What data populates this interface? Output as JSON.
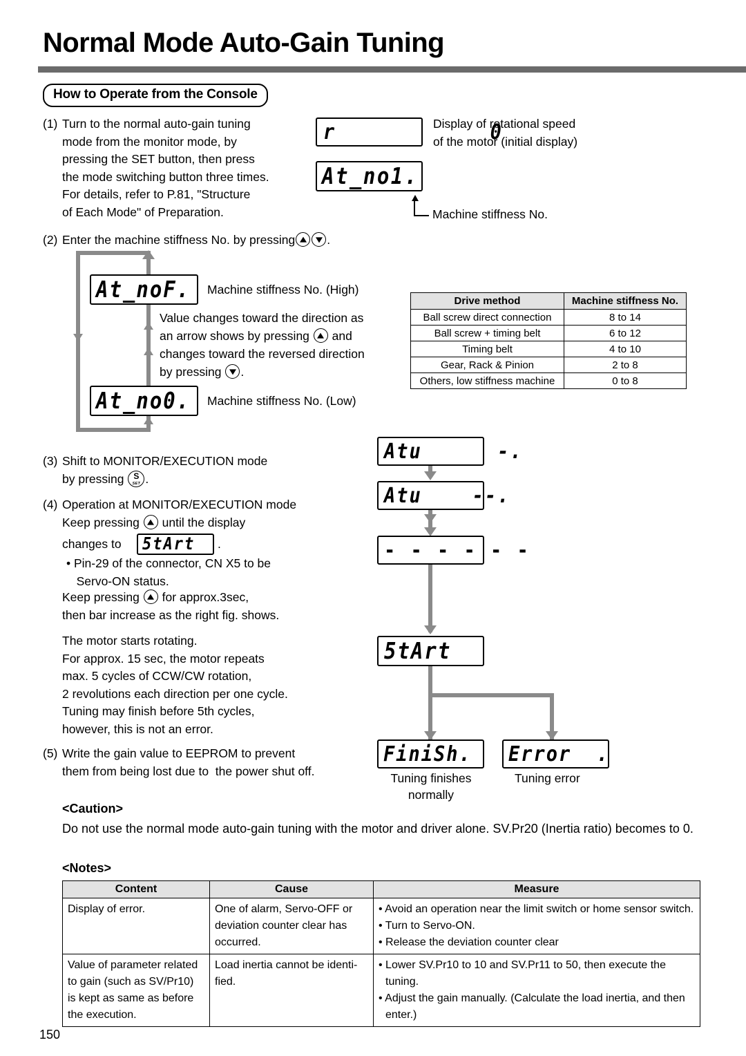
{
  "document": {
    "title": "Normal Mode Auto-Gain Tuning",
    "section_badge": "How to Operate from the Console",
    "page_number": "150"
  },
  "steps": {
    "s1_num": "(1)",
    "s1_lines": "Turn to the normal auto-gain tuning\nmode from the monitor mode, by\npressing the SET button, then press\nthe mode switching button three times.\nFor details, refer to P.81, \"Structure\nof Each Mode\" of Preparation.",
    "s2_num": "(2)",
    "s2_text_a": "Enter the machine stiffness No. by pressing",
    "s2_text_b": ".",
    "s3_num": "(3)",
    "s3_line1": "Shift to MONITOR/EXECUTION mode",
    "s3_line2_a": "by pressing",
    "s3_line2_b": ".",
    "s4_num": "(4)",
    "s4_line1": "Operation at MONITOR/EXECUTION mode",
    "s4_line2_a": "Keep pressing",
    "s4_line2_b": "until the display",
    "s4_line3_a": "changes to",
    "s4_line3_b": ".",
    "s4_bullet": "• Pin-29 of the connector, CN X5 to be\n   Servo-ON status.",
    "s4_line4_a": "Keep pressing",
    "s4_line4_b": "for approx.3sec,",
    "s4_line5": "then bar increase as the right fig. shows.",
    "s4_para": "The motor starts rotating.\nFor approx. 15 sec, the motor repeats\nmax. 5 cycles of CCW/CW rotation,\n2 revolutions each direction per one cycle.\nTuning may finish before 5th cycles,\nhowever, this is not an error.",
    "s5_num": "(5)",
    "s5_lines": "Write the gain value to EEPROM to prevent\nthem from being lost due to  the power shut off."
  },
  "led_displays": {
    "initial_speed": "r             0",
    "at_no1": "At_no1.",
    "at_noF": "At_noF.",
    "at_no0": "At_no0.",
    "atu_1": "Atu      -.",
    "atu_2": "Atu    --.",
    "bars": "- - - - - -",
    "start_inline": "5tArt",
    "start_flow": "5tArt",
    "finish": "FiniSh.",
    "error": "Error  ."
  },
  "annotations": {
    "initial_display": "Display of rotational speed\nof the motor (initial display)",
    "machine_stiffness_no": "Machine stiffness No.",
    "stiffness_high": "Machine stiffness No. (High)",
    "stiffness_low": "Machine stiffness No. (Low)",
    "value_changes": "Value changes toward the direction as",
    "value_changes_2a": "an arrow shows by pressing",
    "value_changes_2b": "and",
    "value_changes_3": "changes toward the reversed direction",
    "value_changes_4a": "by pressing",
    "value_changes_4b": ".",
    "tuning_finishes": "Tuning finishes\nnormally",
    "tuning_error": "Tuning error"
  },
  "drive_table": {
    "headers": [
      "Drive method",
      "Machine stiffness No."
    ],
    "rows": [
      [
        "Ball screw direct connection",
        "8 to 14"
      ],
      [
        "Ball screw + timing belt",
        "6 to 12"
      ],
      [
        "Timing belt",
        "4 to 10"
      ],
      [
        "Gear, Rack & Pinion",
        "2 to 8"
      ],
      [
        "Others, low stiffness machine",
        "0 to 8"
      ]
    ]
  },
  "caution": {
    "heading": "<Caution>",
    "body": "Do not use the normal mode auto-gain tuning with the motor and driver alone. SV.Pr20 (Inertia ratio) becomes to 0."
  },
  "notes": {
    "heading": "<Notes>",
    "headers": [
      "Content",
      "Cause",
      "Measure"
    ],
    "rows": [
      {
        "content": "Display of error.",
        "cause": "One of alarm, Servo-OFF or deviation counter clear has occurred.",
        "measures": [
          "• Avoid an operation near the limit switch or home sensor switch.",
          "• Turn to Servo-ON.",
          "• Release the deviation counter clear"
        ]
      },
      {
        "content": "Value of parameter related to gain (such as SV/Pr10) is kept as same as before the execution.",
        "cause": "Load inertia cannot be identi-fied.",
        "measures": [
          "• Lower SV.Pr10 to 10 and SV.Pr11 to 50, then execute the tuning.",
          "• Adjust the gain manually. (Calculate the load inertia, and then enter.)"
        ]
      }
    ]
  },
  "colors": {
    "rule": "#6b6b6b",
    "flow_arrow": "#8a8a8a",
    "table_header_bg": "#e2e2e2"
  }
}
